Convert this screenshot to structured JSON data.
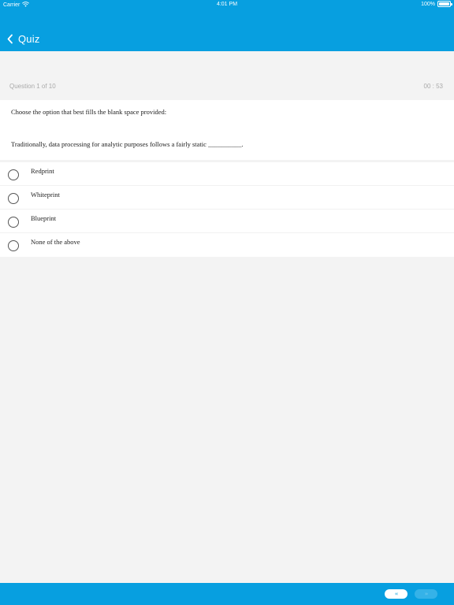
{
  "status_bar": {
    "carrier": "Carrier",
    "time": "4:01 PM",
    "battery": "100%",
    "battery_level": 1.0,
    "wifi_icon": "wifi-icon",
    "battery_icon": "battery-icon"
  },
  "nav": {
    "back_icon": "chevron-left-icon",
    "title": "Quiz"
  },
  "quiz": {
    "progress": "Question 1 of 10",
    "timer": "00 : 53",
    "instruction": "Choose the option that best fills the blank space provided:",
    "question": "Traditionally, data processing for analytic purposes follows a fairly static __________.",
    "options": [
      {
        "label": "Redprint",
        "selected": false
      },
      {
        "label": "Whiteprint",
        "selected": false
      },
      {
        "label": "Blueprint",
        "selected": false
      },
      {
        "label": "None of the above",
        "selected": false
      }
    ]
  },
  "footer": {
    "prev_label": "‹‹",
    "next_label": "››",
    "next_enabled": false
  },
  "colors": {
    "brand": "#079fe0",
    "background": "#f3f3f3",
    "card": "#ffffff"
  }
}
